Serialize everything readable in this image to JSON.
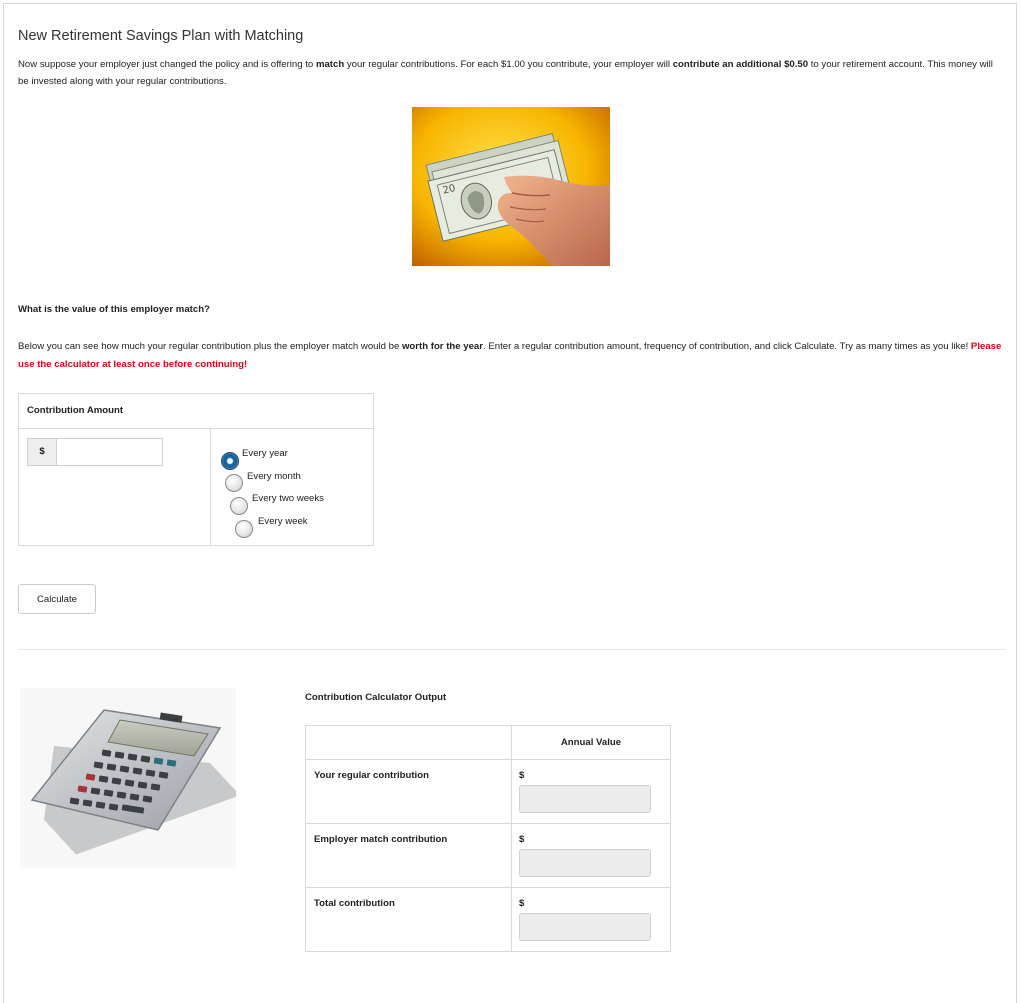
{
  "page": {
    "title": "New Retirement Savings Plan with Matching",
    "intro": {
      "t1": "Now suppose your employer just changed the policy and is offering to ",
      "b1": "match",
      "t2": " your regular contributions. For each $1.00 you contribute, your employer will ",
      "b2": "contribute an additional $0.50",
      "t3": " to your retirement account. This money will be invested along with your regular contributions."
    },
    "question": "What is the value of this employer match?",
    "description": {
      "t1": "Below you can see how much your regular contribution plus the employer match would be ",
      "b1": "worth for the year",
      "t2": ". Enter a regular contribution amount, frequency of contribution, and click Calculate. Try as many times as you like! ",
      "warning": "Please use the calculator at least once before continuing!"
    }
  },
  "contribution": {
    "heading": "Contribution Amount",
    "currency_symbol": "$",
    "amount_value": "",
    "frequency_options": [
      "Every year",
      "Every month",
      "Every two weeks",
      "Every week"
    ],
    "selected_frequency": "Every year"
  },
  "calculate_button": "Calculate",
  "output": {
    "title": "Contribution Calculator Output",
    "column_header": "Annual Value",
    "rows": [
      {
        "label": "Your regular contribution",
        "currency": "$",
        "value": ""
      },
      {
        "label": "Employer match contribution",
        "currency": "$",
        "value": ""
      },
      {
        "label": "Total contribution",
        "currency": "$",
        "value": ""
      }
    ]
  },
  "images": {
    "money": "hand-holding-cash-icon",
    "calculator": "calculator-icon"
  },
  "colors": {
    "warning": "#e60012",
    "radio_selected": "#1f6ca8",
    "money_background": "#f2b400"
  }
}
